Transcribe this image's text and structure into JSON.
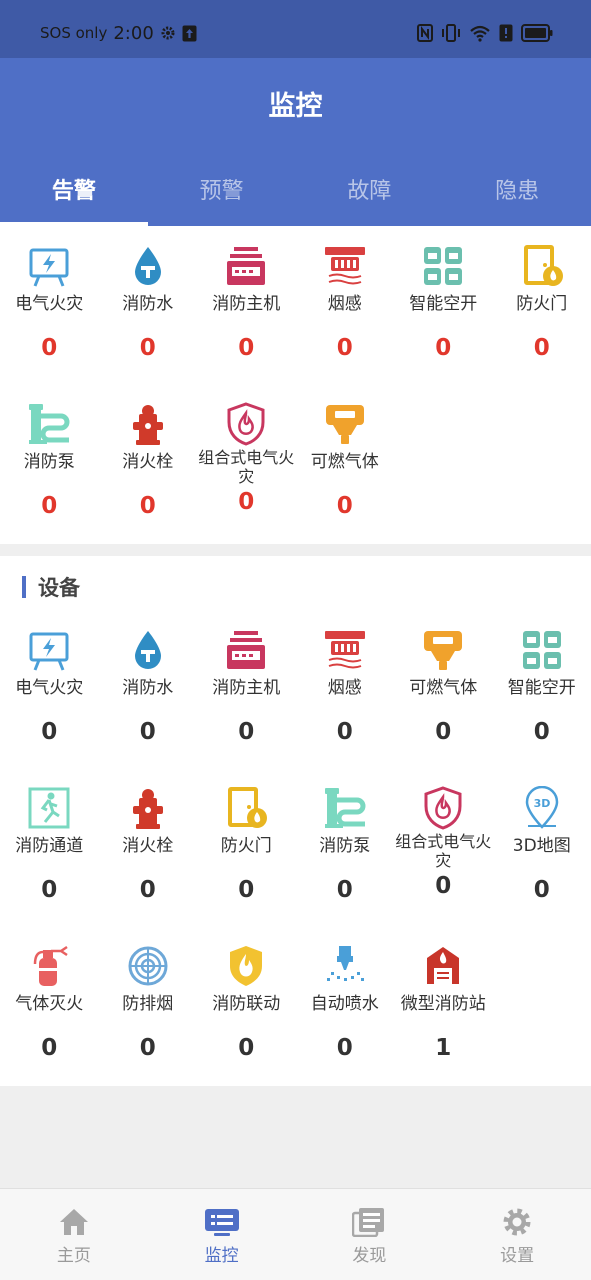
{
  "status_bar": {
    "carrier": "SOS only",
    "time": "2:00"
  },
  "header": {
    "title": "监控"
  },
  "tabs": [
    {
      "label": "告警"
    },
    {
      "label": "预警"
    },
    {
      "label": "故障"
    },
    {
      "label": "隐患"
    }
  ],
  "alarm_items": [
    {
      "label": "电气火灾",
      "count": "0",
      "icon": "electric-fire-icon"
    },
    {
      "label": "消防水",
      "count": "0",
      "icon": "fire-water-icon"
    },
    {
      "label": "消防主机",
      "count": "0",
      "icon": "fire-host-icon"
    },
    {
      "label": "烟感",
      "count": "0",
      "icon": "smoke-detector-icon"
    },
    {
      "label": "智能空开",
      "count": "0",
      "icon": "smart-switch-icon"
    },
    {
      "label": "防火门",
      "count": "0",
      "icon": "fire-door-icon"
    },
    {
      "label": "消防泵",
      "count": "0",
      "icon": "fire-pump-icon"
    },
    {
      "label": "消火栓",
      "count": "0",
      "icon": "hydrant-icon"
    },
    {
      "label": "组合式电气火灾",
      "count": "0",
      "icon": "combined-fire-icon"
    },
    {
      "label": "可燃气体",
      "count": "0",
      "icon": "combustible-gas-icon"
    }
  ],
  "device_section": {
    "title": "设备"
  },
  "device_items": [
    {
      "label": "电气火灾",
      "count": "0",
      "icon": "electric-fire-icon"
    },
    {
      "label": "消防水",
      "count": "0",
      "icon": "fire-water-icon"
    },
    {
      "label": "消防主机",
      "count": "0",
      "icon": "fire-host-icon"
    },
    {
      "label": "烟感",
      "count": "0",
      "icon": "smoke-detector-icon"
    },
    {
      "label": "可燃气体",
      "count": "0",
      "icon": "combustible-gas-icon"
    },
    {
      "label": "智能空开",
      "count": "0",
      "icon": "smart-switch-icon"
    },
    {
      "label": "消防通道",
      "count": "0",
      "icon": "fire-exit-icon"
    },
    {
      "label": "消火栓",
      "count": "0",
      "icon": "hydrant-icon"
    },
    {
      "label": "防火门",
      "count": "0",
      "icon": "fire-door-icon"
    },
    {
      "label": "消防泵",
      "count": "0",
      "icon": "fire-pump-icon"
    },
    {
      "label": "组合式电气火灾",
      "count": "0",
      "icon": "combined-fire-icon"
    },
    {
      "label": "3D地图",
      "count": "0",
      "icon": "map-3d-icon"
    },
    {
      "label": "气体灭火",
      "count": "0",
      "icon": "gas-extinguisher-icon"
    },
    {
      "label": "防排烟",
      "count": "0",
      "icon": "smoke-exhaust-icon"
    },
    {
      "label": "消防联动",
      "count": "0",
      "icon": "fire-linkage-icon"
    },
    {
      "label": "自动喷水",
      "count": "0",
      "icon": "sprinkler-icon"
    },
    {
      "label": "微型消防站",
      "count": "1",
      "icon": "mini-fire-station-icon"
    }
  ],
  "bottom_nav": [
    {
      "label": "主页",
      "icon": "home-icon"
    },
    {
      "label": "监控",
      "icon": "monitor-icon"
    },
    {
      "label": "发现",
      "icon": "discover-icon"
    },
    {
      "label": "设置",
      "icon": "settings-icon"
    }
  ],
  "colors": {
    "primary": "#4f6fc6",
    "status_bar": "#3f5aa6",
    "alarm_count": "#e1372c"
  }
}
